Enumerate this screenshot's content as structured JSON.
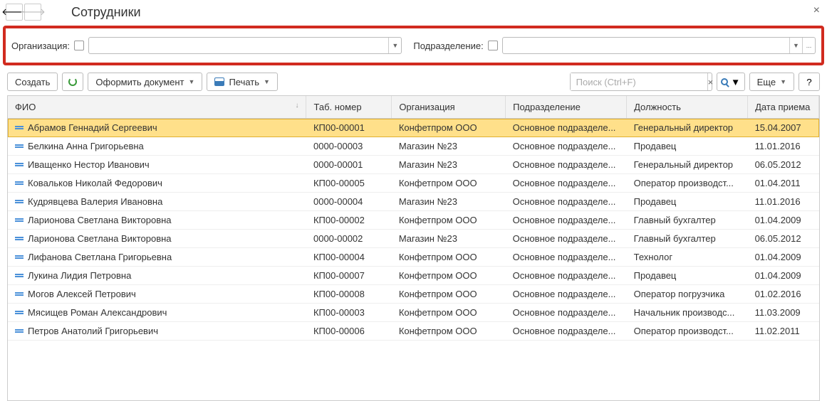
{
  "header": {
    "title": "Сотрудники"
  },
  "filter": {
    "org_label": "Организация:",
    "dept_label": "Подразделение:",
    "org_value": "",
    "dept_value": "",
    "ellipsis": "..."
  },
  "toolbar": {
    "create": "Создать",
    "doc": "Оформить документ",
    "print": "Печать",
    "search_placeholder": "Поиск (Ctrl+F)",
    "more": "Еще",
    "help": "?"
  },
  "columns": {
    "fio": "ФИО",
    "tab": "Таб. номер",
    "org": "Организация",
    "dept": "Подразделение",
    "pos": "Должность",
    "date": "Дата приема",
    "sort": "↓"
  },
  "rows": [
    {
      "fio": "Абрамов Геннадий Сергеевич",
      "tab": "КП00-00001",
      "org": "Конфетпром ООО",
      "dept": "Основное подразделе...",
      "pos": "Генеральный директор",
      "date": "15.04.2007",
      "selected": true
    },
    {
      "fio": "Белкина Анна Григорьевна",
      "tab": "0000-00003",
      "org": "Магазин №23",
      "dept": "Основное подразделе...",
      "pos": "Продавец",
      "date": "11.01.2016"
    },
    {
      "fio": "Иващенко Нестор Иванович",
      "tab": "0000-00001",
      "org": "Магазин №23",
      "dept": "Основное подразделе...",
      "pos": "Генеральный директор",
      "date": "06.05.2012"
    },
    {
      "fio": "Ковальков Николай Федорович",
      "tab": "КП00-00005",
      "org": "Конфетпром ООО",
      "dept": "Основное подразделе...",
      "pos": "Оператор производст...",
      "date": "01.04.2011"
    },
    {
      "fio": "Кудрявцева Валерия Ивановна",
      "tab": "0000-00004",
      "org": "Магазин №23",
      "dept": "Основное подразделе...",
      "pos": "Продавец",
      "date": "11.01.2016"
    },
    {
      "fio": "Ларионова Светлана Викторовна",
      "tab": "КП00-00002",
      "org": "Конфетпром ООО",
      "dept": "Основное подразделе...",
      "pos": "Главный бухгалтер",
      "date": "01.04.2009"
    },
    {
      "fio": "Ларионова Светлана Викторовна",
      "tab": "0000-00002",
      "org": "Магазин №23",
      "dept": "Основное подразделе...",
      "pos": "Главный бухгалтер",
      "date": "06.05.2012"
    },
    {
      "fio": "Лифанова Светлана Григорьевна",
      "tab": "КП00-00004",
      "org": "Конфетпром ООО",
      "dept": "Основное подразделе...",
      "pos": "Технолог",
      "date": "01.04.2009"
    },
    {
      "fio": "Лукина Лидия Петровна",
      "tab": "КП00-00007",
      "org": "Конфетпром ООО",
      "dept": "Основное подразделе...",
      "pos": "Продавец",
      "date": "01.04.2009"
    },
    {
      "fio": "Могов Алексей Петрович",
      "tab": "КП00-00008",
      "org": "Конфетпром ООО",
      "dept": "Основное подразделе...",
      "pos": "Оператор погрузчика",
      "date": "01.02.2016"
    },
    {
      "fio": "Мясищев Роман Александрович",
      "tab": "КП00-00003",
      "org": "Конфетпром ООО",
      "dept": "Основное подразделе...",
      "pos": "Начальник производс...",
      "date": "11.03.2009"
    },
    {
      "fio": "Петров Анатолий Григорьевич",
      "tab": "КП00-00006",
      "org": "Конфетпром ООО",
      "dept": "Основное подразделе...",
      "pos": "Оператор производст...",
      "date": "11.02.2011"
    }
  ]
}
